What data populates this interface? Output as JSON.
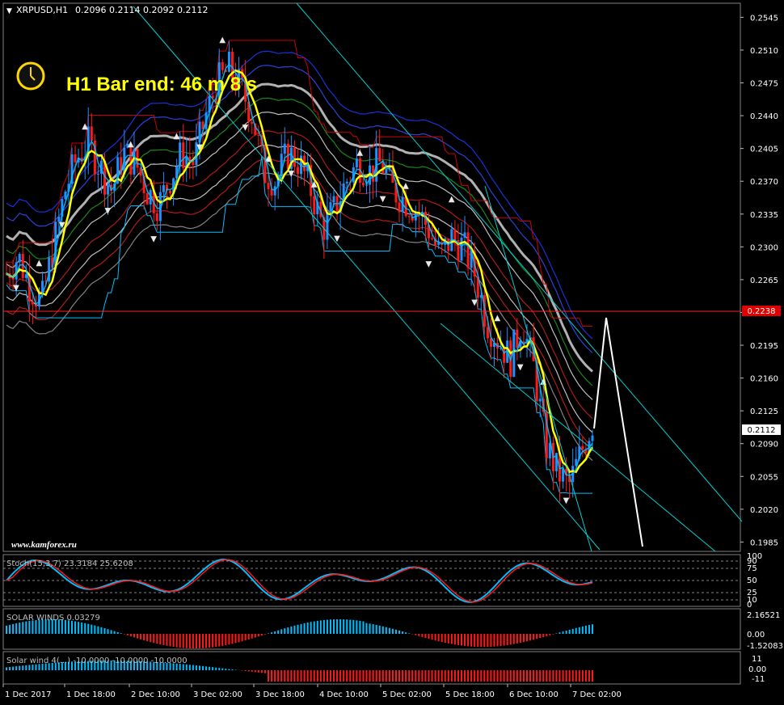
{
  "header": {
    "symbol_label": "XRPUSD,H1",
    "ohlc": "0.2096 0.2114 0.2092 0.2112"
  },
  "timer": {
    "label": "H1 Bar end: 46 m 8 s",
    "icon": "clock-icon"
  },
  "watermark": "www.kamforex.ru",
  "price_tags": {
    "current": "0.2112",
    "horizontal_line": "0.2238"
  },
  "colors": {
    "background": "#000000",
    "bull": "#1e90ff",
    "bear": "#ff1a1a",
    "yellow_ma": "#ffff00",
    "cyan": "#00bfff",
    "horizontal_line": "#ff2020"
  },
  "subwindows": {
    "stoch_label": "Stoch(15,3,7) 23.3184 25.6208",
    "stoch_levels": [
      "100",
      "90",
      "75",
      "50",
      "25",
      "10",
      "0"
    ],
    "solar_winds_label": "SOLAR WINDS 0.03279",
    "solar_winds_scale": [
      "2.16521",
      "0.00",
      "-1.52083"
    ],
    "solar_wind_label": "Solar wind 4(...) -10.0000 -10.0000 -10.0000",
    "solar_wind_scale": [
      "11",
      "0.00",
      "-11"
    ]
  },
  "chart_data": {
    "type": "candlestick",
    "symbol": "XRPUSD",
    "timeframe": "H1",
    "y_ticks": [
      "0.2545",
      "0.2510",
      "0.2475",
      "0.2440",
      "0.2405",
      "0.2370",
      "0.2335",
      "0.2300",
      "0.2265",
      "0.2230",
      "0.2195",
      "0.2160",
      "0.2125",
      "0.2090",
      "0.2055",
      "0.2020",
      "0.1985"
    ],
    "ylim": [
      0.1975,
      0.256
    ],
    "x_ticks": [
      "1 Dec 2017",
      "1 Dec 18:00",
      "2 Dec 10:00",
      "3 Dec 02:00",
      "3 Dec 18:00",
      "4 Dec 10:00",
      "5 Dec 02:00",
      "5 Dec 18:00",
      "6 Dec 10:00",
      "7 Dec 02:00"
    ],
    "close_path": [
      0.2272,
      0.229,
      0.2258,
      0.224,
      0.23,
      0.236,
      0.2395,
      0.241,
      0.2385,
      0.236,
      0.24,
      0.239,
      0.236,
      0.2345,
      0.2375,
      0.24,
      0.239,
      0.244,
      0.2475,
      0.249,
      0.247,
      0.244,
      0.238,
      0.237,
      0.24,
      0.239,
      0.236,
      0.232,
      0.234,
      0.237,
      0.239,
      0.238,
      0.239,
      0.236,
      0.235,
      0.234,
      0.232,
      0.229,
      0.231,
      0.23,
      0.227,
      0.222,
      0.22,
      0.218,
      0.222,
      0.217,
      0.209,
      0.206,
      0.2045,
      0.208,
      0.2112
    ],
    "current_price": 0.2112,
    "horizontal_line": 0.2238
  }
}
